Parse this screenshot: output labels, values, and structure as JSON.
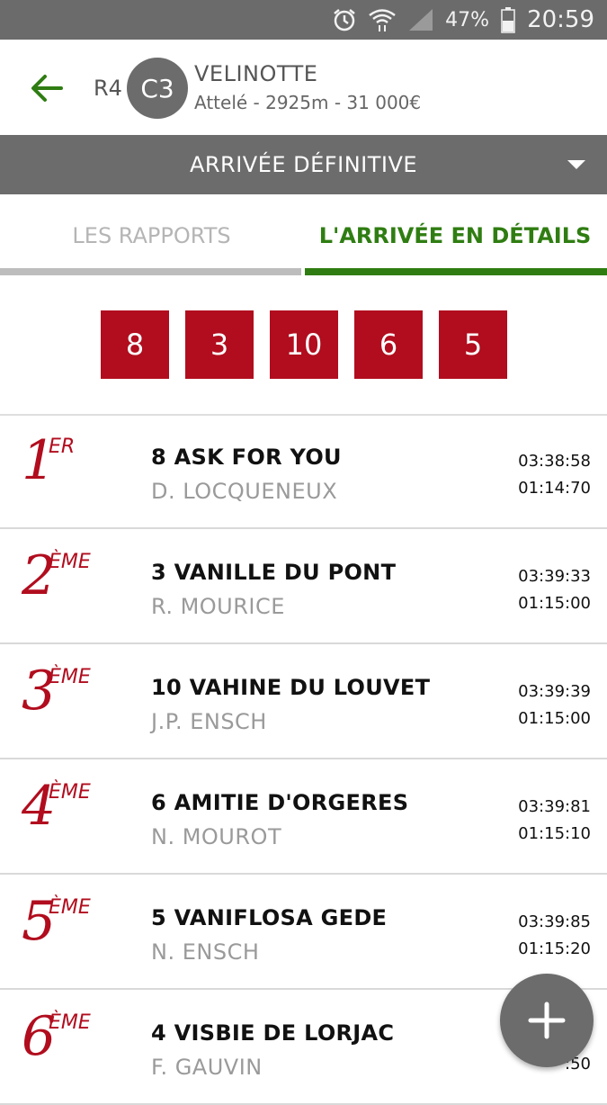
{
  "status_bar": {
    "battery": "47%",
    "time": "20:59",
    "icons": [
      "alarm-icon",
      "wifi-icon",
      "signal-icon",
      "battery-icon"
    ]
  },
  "header": {
    "reunion": "R4",
    "course": "C3",
    "race_name": "VELINOTTE",
    "race_info": "Attelé - 2925m - 31 000€"
  },
  "dropdown": {
    "selected": "ARRIVÉE DÉFINITIVE"
  },
  "tabs": [
    {
      "label": "LES RAPPORTS",
      "active": false
    },
    {
      "label": "L'ARRIVÉE EN DÉTAILS",
      "active": true
    }
  ],
  "arrival_numbers": [
    "8",
    "3",
    "10",
    "6",
    "5"
  ],
  "results": [
    {
      "place": "1",
      "suffix": "ER",
      "horse": "8 ASK FOR YOU",
      "driver": "D. LOCQUENEUX",
      "time": "03:38:58",
      "reduction": "01:14:70"
    },
    {
      "place": "2",
      "suffix": "ÈME",
      "horse": "3 VANILLE DU PONT",
      "driver": "R. MOURICE",
      "time": "03:39:33",
      "reduction": "01:15:00"
    },
    {
      "place": "3",
      "suffix": "ÈME",
      "horse": "10 VAHINE DU LOUVET",
      "driver": "J.P. ENSCH",
      "time": "03:39:39",
      "reduction": "01:15:00"
    },
    {
      "place": "4",
      "suffix": "ÈME",
      "horse": "6 AMITIE D'ORGERES",
      "driver": "N. MOUROT",
      "time": "03:39:81",
      "reduction": "01:15:10"
    },
    {
      "place": "5",
      "suffix": "ÈME",
      "horse": "5 VANIFLOSA GEDE",
      "driver": "N. ENSCH",
      "time": "03:39:85",
      "reduction": "01:15:20"
    },
    {
      "place": "6",
      "suffix": "ÈME",
      "horse": "4 VISBIE DE LORJAC",
      "driver": "F. GAUVIN",
      "time": "",
      "reduction": ":50"
    }
  ],
  "colors": {
    "accent_green": "#2f7d12",
    "accent_red": "#b10d1e",
    "bar_grey": "#6c6c6c"
  }
}
